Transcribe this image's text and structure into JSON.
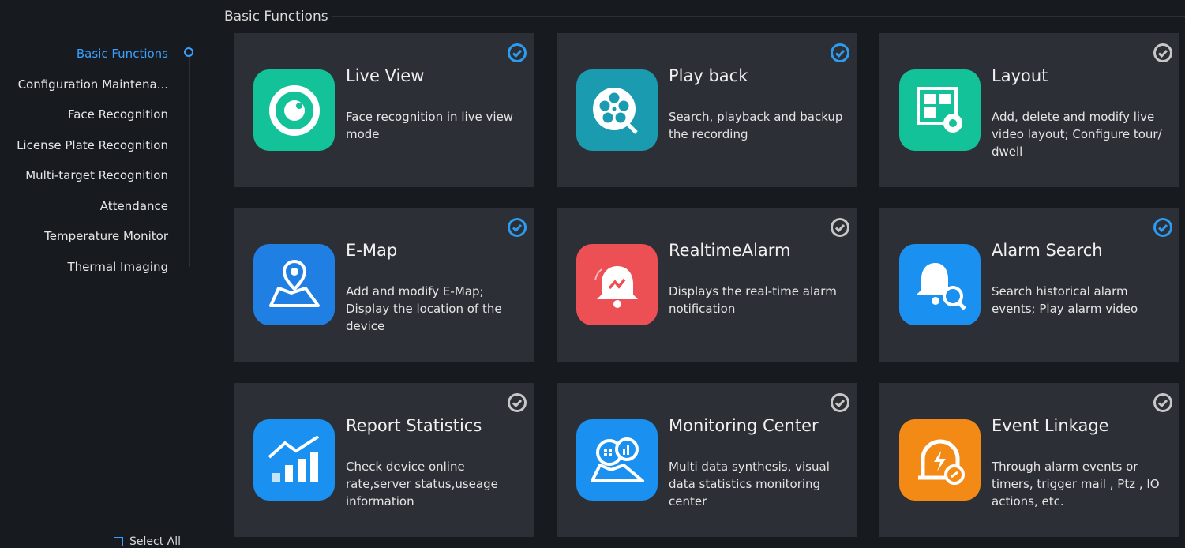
{
  "sidebar": {
    "items": [
      {
        "label": "Basic Functions",
        "active": true
      },
      {
        "label": "Configuration Maintena..."
      },
      {
        "label": "Face Recognition"
      },
      {
        "label": "License Plate Recognition"
      },
      {
        "label": "Multi-target Recognition"
      },
      {
        "label": "Attendance"
      },
      {
        "label": "Temperature Monitor"
      },
      {
        "label": "Thermal Imaging"
      }
    ],
    "select_all": "Select All"
  },
  "section": {
    "title": "Basic Functions"
  },
  "cards": [
    {
      "title": "Live View",
      "desc": "Face recognition in live view mode",
      "checked": true,
      "icon": "live-view-icon",
      "color": "#14c29a"
    },
    {
      "title": "Play back",
      "desc": "Search, playback and backup the recording",
      "checked": true,
      "icon": "playback-film-reel-icon",
      "color": "#1a9bb0"
    },
    {
      "title": "Layout",
      "desc": "Add, delete and modify live video layout; Configure tour/ dwell",
      "checked": false,
      "icon": "layout-settings-icon",
      "color": "#14c29a"
    },
    {
      "title": "E-Map",
      "desc": "Add and modify E-Map; Display the location of the device",
      "checked": true,
      "icon": "map-pin-icon",
      "color": "#1f7fe3"
    },
    {
      "title": "RealtimeAlarm",
      "desc": "Displays the real-time alarm notification",
      "checked": false,
      "icon": "alarm-bell-icon",
      "color": "#ec4f54"
    },
    {
      "title": "Alarm Search",
      "desc": "Search historical alarm events; Play alarm video",
      "checked": true,
      "icon": "alarm-search-icon",
      "color": "#1a91f0"
    },
    {
      "title": "Report Statistics",
      "desc": "Check device online rate,server status,useage information",
      "checked": false,
      "icon": "report-chart-icon",
      "color": "#1a91f0"
    },
    {
      "title": "Monitoring Center",
      "desc": "Multi data synthesis, visual data statistics monitoring center",
      "checked": false,
      "icon": "monitoring-center-icon",
      "color": "#1a91f0"
    },
    {
      "title": "Event Linkage",
      "desc": "Through alarm events or timers, trigger mail , Ptz , IO actions, etc.",
      "checked": false,
      "icon": "event-linkage-icon",
      "color": "#f38a16"
    }
  ],
  "colors": {
    "accent": "#3aa0ff",
    "check_on": "#2d9bf0",
    "check_off": "#c7c7c7"
  }
}
